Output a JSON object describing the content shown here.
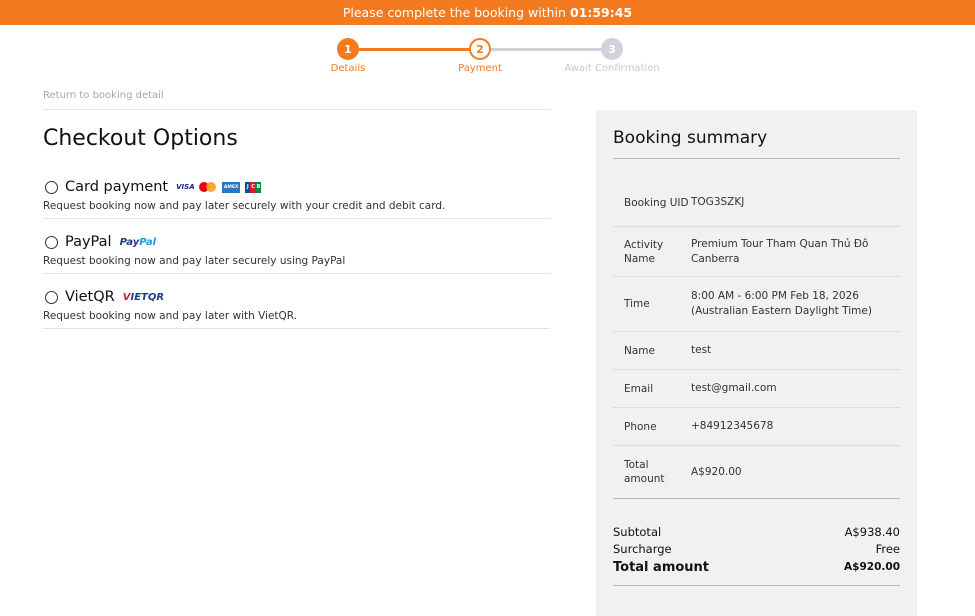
{
  "timer": {
    "prefix": "Please complete the booking within",
    "time": "01:59:45"
  },
  "stepper": {
    "steps": [
      {
        "number": "1",
        "label": "Details"
      },
      {
        "number": "2",
        "label": "Payment"
      },
      {
        "number": "3",
        "label": "Await Confirmation"
      }
    ]
  },
  "nav": {
    "back_link": "Return to booking detail"
  },
  "checkout": {
    "title": "Checkout Options",
    "options": [
      {
        "name": "Card payment",
        "description": "Request booking now and pay later securely with your credit and debit card.",
        "logos": [
          "visa-logo",
          "mastercard-logo",
          "amex-logo",
          "jcb-logo"
        ]
      },
      {
        "name": "PayPal",
        "description": "Request booking now and pay later securely using PayPal",
        "logos": [
          "paypal-logo"
        ]
      },
      {
        "name": "VietQR",
        "description": "Request booking now and pay later with VietQR.",
        "logos": [
          "vietqr-logo"
        ]
      }
    ],
    "logo_text": {
      "visa": "VISA",
      "amex": "AMEX",
      "jcb": [
        "J",
        "C",
        "B"
      ],
      "paypal": [
        "Pay",
        "Pal"
      ],
      "vietqr": [
        "V",
        "IETQR"
      ]
    }
  },
  "summary": {
    "title": "Booking summary",
    "rows": [
      {
        "label": "Booking UID",
        "value": "TOG3SZKJ"
      },
      {
        "label": "Activity Name",
        "value": "Premium Tour Tham Quan Thủ Đô Canberra"
      },
      {
        "label": "Time",
        "value": "8:00 AM - 6:00 PM Feb 18, 2026 (Australian Eastern Daylight Time)"
      },
      {
        "label": "Name",
        "value": "test"
      },
      {
        "label": "Email",
        "value": "test@gmail.com"
      },
      {
        "label": "Phone",
        "value": "+84912345678"
      },
      {
        "label": "Total amount",
        "value": "A$920.00"
      }
    ],
    "subtotal_label": "Subtotal",
    "subtotal_value": "A$938.40",
    "surcharge_label": "Surcharge",
    "surcharge_value": "Free",
    "total_label": "Total amount",
    "total_value": "A$920.00"
  },
  "colors": {
    "accent": "#f47a20",
    "inactive": "#cfd3d9",
    "panel": "#f1f1f1"
  }
}
